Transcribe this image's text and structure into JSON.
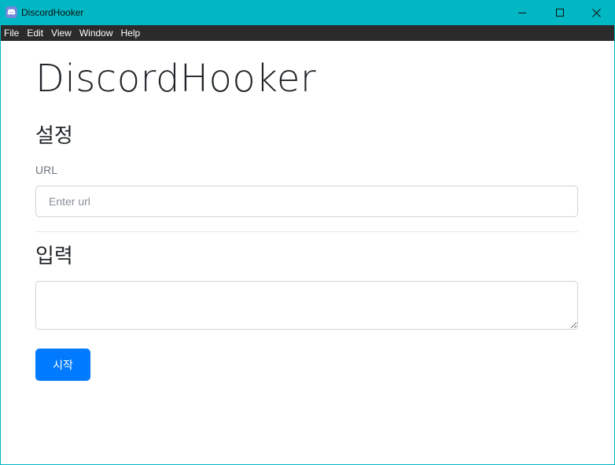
{
  "window": {
    "title": "DiscordHooker",
    "icon": "discord-icon",
    "controls": [
      "minimize-icon",
      "maximize-icon",
      "close-icon"
    ],
    "titlebar_color": "#00b7c3"
  },
  "menu": {
    "items": [
      {
        "label": "File"
      },
      {
        "label": "Edit"
      },
      {
        "label": "View"
      },
      {
        "label": "Window"
      },
      {
        "label": "Help"
      }
    ]
  },
  "main": {
    "heading": "DiscordHooker",
    "settings": {
      "title": "설정",
      "url_label": "URL",
      "url_value": "",
      "url_placeholder": "Enter url"
    },
    "input_section": {
      "title": "입력",
      "message_value": ""
    },
    "start_button_label": "시작",
    "accent_color": "#007bff"
  }
}
